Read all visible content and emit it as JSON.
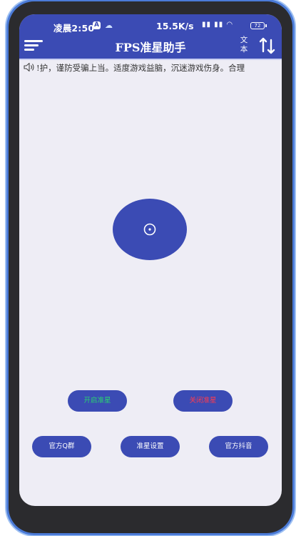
{
  "status_bar": {
    "time": "凌晨2:50",
    "badge": "A",
    "speed": "15.5K/s",
    "battery": "72"
  },
  "header": {
    "title": "FPS准星助手",
    "text_toggle_line1": "文",
    "text_toggle_line2": "本"
  },
  "marquee": {
    "text": "!护，谨防受骗上当。适度游戏益脑，沉迷游戏伤身。合理"
  },
  "buttons": {
    "start_crosshair": "开启准星",
    "close_crosshair": "关闭准星",
    "official_qq": "官方Q群",
    "crosshair_settings": "准星设置",
    "official_douyin": "官方抖音"
  },
  "colors": {
    "primary": "#3b4bb4",
    "background": "#eeedf5",
    "start_text": "#29d66f",
    "close_text": "#ff3b4e"
  },
  "icons": {
    "menu": "hamburger-menu-icon",
    "sort": "sort-arrows-icon",
    "speaker": "speaker-icon",
    "crosshair": "crosshair-icon"
  }
}
